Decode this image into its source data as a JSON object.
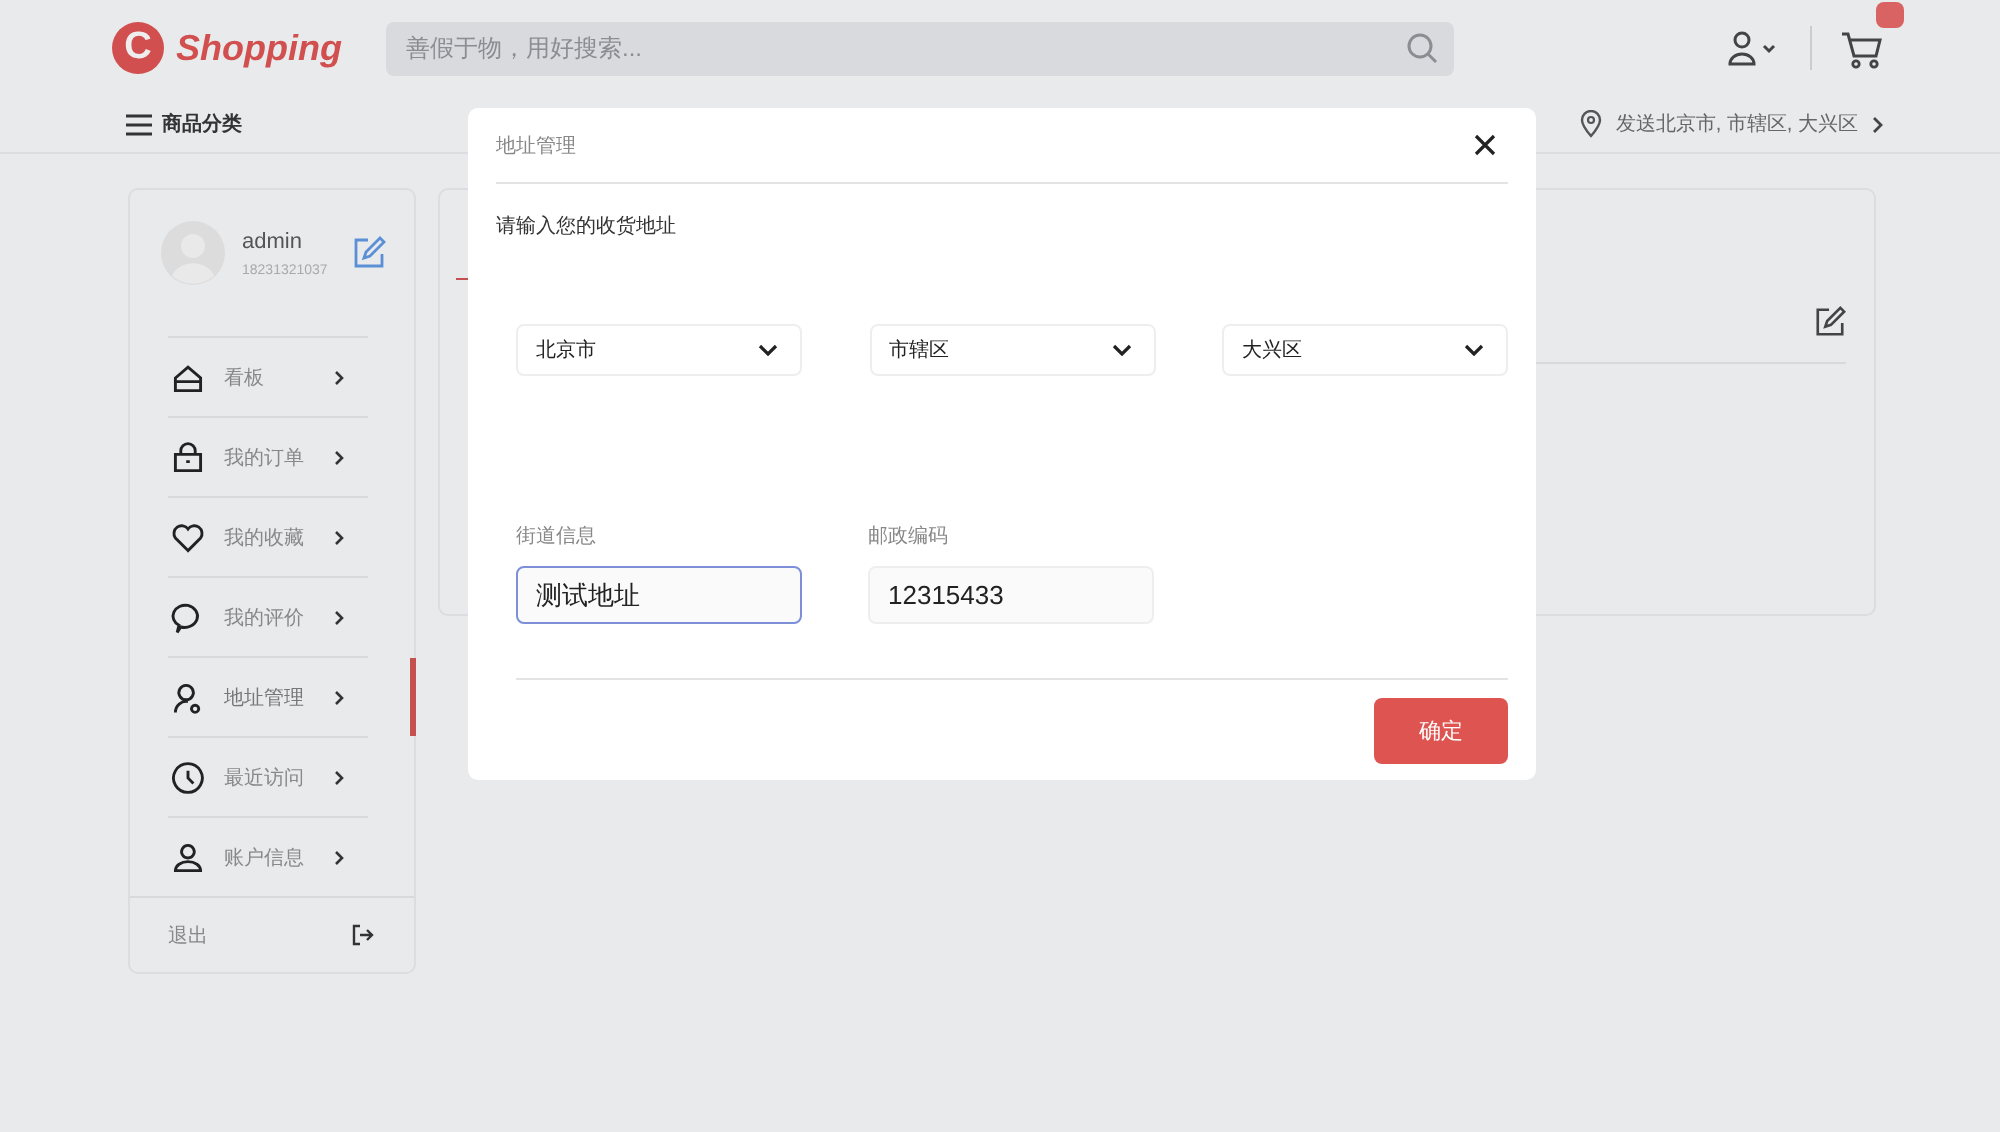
{
  "header": {
    "logo_letter": "C",
    "logo_text": "Shopping",
    "search": {
      "placeholder": "善假于物，用好搜索..."
    },
    "cart_badge": true
  },
  "subnav": {
    "menu": "商品分类",
    "location": "发送北京市, 市辖区, 大兴区"
  },
  "profile": {
    "name": "admin",
    "phone": "18231321037"
  },
  "sidebar": {
    "items": [
      {
        "label": "看板",
        "selected": false
      },
      {
        "label": "我的订单",
        "selected": false
      },
      {
        "label": "我的收藏",
        "selected": false
      },
      {
        "label": "我的评价",
        "selected": false
      },
      {
        "label": "地址管理",
        "selected": true
      },
      {
        "label": "最近访问",
        "selected": false
      },
      {
        "label": "账户信息",
        "selected": false
      }
    ],
    "logout": "退出"
  },
  "dialog": {
    "title": "地址管理",
    "intro": "请输入您的收货地址",
    "selects": [
      {
        "value": "北京市"
      },
      {
        "value": "市辖区"
      },
      {
        "value": "大兴区"
      }
    ],
    "fields": [
      {
        "label": "街道信息",
        "value": "测试地址",
        "focused": true
      },
      {
        "label": "邮政编码",
        "value": "12315433",
        "focused": false
      }
    ],
    "confirm": "确定"
  }
}
